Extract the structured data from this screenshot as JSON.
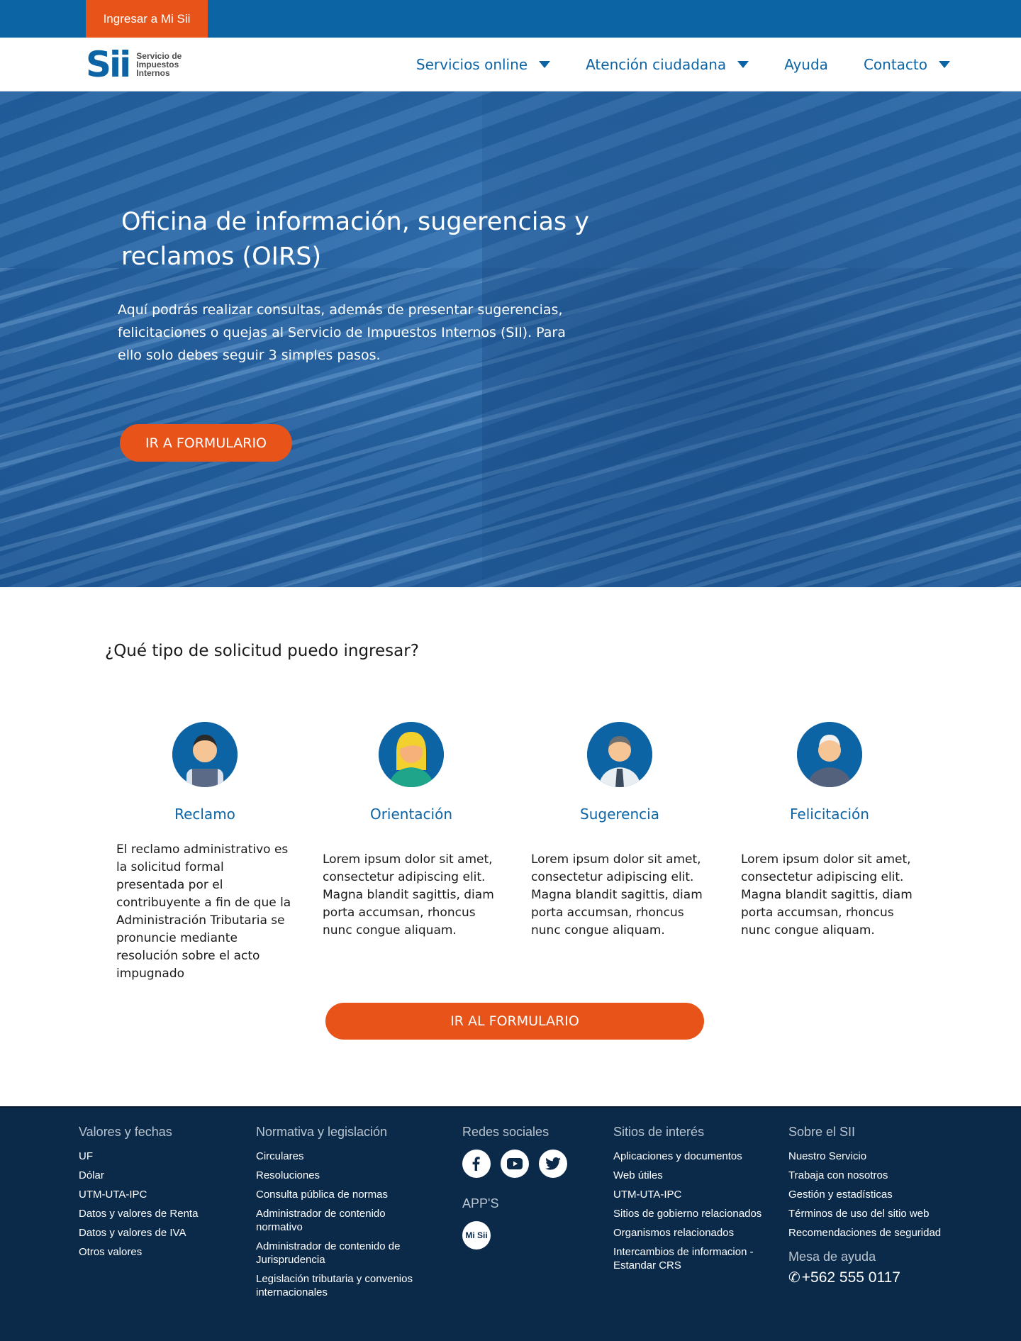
{
  "topbar": {
    "login_label": "Ingresar a Mi Sii"
  },
  "header": {
    "logo_mark": "Sii",
    "logo_name": [
      "Servicio de",
      "Impuestos",
      "Internos"
    ],
    "nav": [
      {
        "label": "Servicios online",
        "dropdown": true
      },
      {
        "label": "Atención ciudadana",
        "dropdown": true
      },
      {
        "label": "Ayuda",
        "dropdown": false
      },
      {
        "label": "Contacto",
        "dropdown": true
      }
    ]
  },
  "hero": {
    "title": "Oficina de información, sugerencias y reclamos (OIRS)",
    "text": "Aquí podrás realizar consultas, además de presentar sugerencias, felicitaciones o quejas al Servicio de Impuestos Internos (SII). Para ello solo debes seguir 3 simples pasos.",
    "button": "IR A FORMULARIO"
  },
  "section": {
    "question": "¿Qué tipo de solicitud puedo ingresar?",
    "cards": [
      {
        "title": "Reclamo",
        "text": "El reclamo administrativo es la solicitud formal presentada por el contribuyente a fin de que la Administración Tributaria se pronuncie mediante resolución sobre el acto impugnado"
      },
      {
        "title": "Orientación",
        "text": "Lorem ipsum dolor sit amet, consectetur adipiscing elit. Magna blandit sagittis, diam porta accumsan, rhoncus nunc congue aliquam."
      },
      {
        "title": "Sugerencia",
        "text": "Lorem ipsum dolor sit amet, consectetur adipiscing elit. Magna blandit sagittis, diam porta accumsan, rhoncus nunc congue aliquam."
      },
      {
        "title": "Felicitación",
        "text": "Lorem ipsum dolor sit amet, consectetur adipiscing elit. Magna blandit sagittis, diam porta accumsan, rhoncus nunc congue aliquam."
      }
    ],
    "button": "IR AL FORMULARIO"
  },
  "footer": {
    "valores": {
      "title": "Valores y fechas",
      "links": [
        "UF",
        "Dólar",
        "UTM-UTA-IPC",
        "Datos y valores de  Renta",
        "Datos y valores de  IVA",
        "Otros valores"
      ]
    },
    "normativa": {
      "title": "Normativa y legislación",
      "links": [
        "Circulares",
        "Resoluciones",
        "Consulta pública de normas",
        "Administrador de contenido normativo",
        "Administrador de contenido de Jurisprudencia",
        "Legislación tributaria y convenios internacionales"
      ]
    },
    "redes": {
      "title": "Redes sociales",
      "icons": [
        "facebook-icon",
        "youtube-icon",
        "twitter-icon"
      ],
      "apps_title": "APP'S",
      "app_label": "Mi Sii"
    },
    "sitios": {
      "title": "Sitios de interés",
      "links": [
        "Aplicaciones y documentos",
        "Web útiles",
        "UTM-UTA-IPC",
        "Sitios de gobierno relacionados",
        "Organismos relacionados",
        "Intercambios de informacion - Estandar CRS"
      ]
    },
    "sobre": {
      "title": "Sobre el SII",
      "links": [
        "Nuestro Servicio",
        "Trabaja con nosotros",
        "Gestión y estadísticas",
        "Términos de uso del sitio web",
        "Recomendaciones de seguridad"
      ],
      "help_title": "Mesa de ayuda",
      "phone": "+562 555 0117"
    }
  },
  "colors": {
    "primary": "#0d64a4",
    "accent": "#e8531a",
    "footer": "#0b2a4a"
  }
}
